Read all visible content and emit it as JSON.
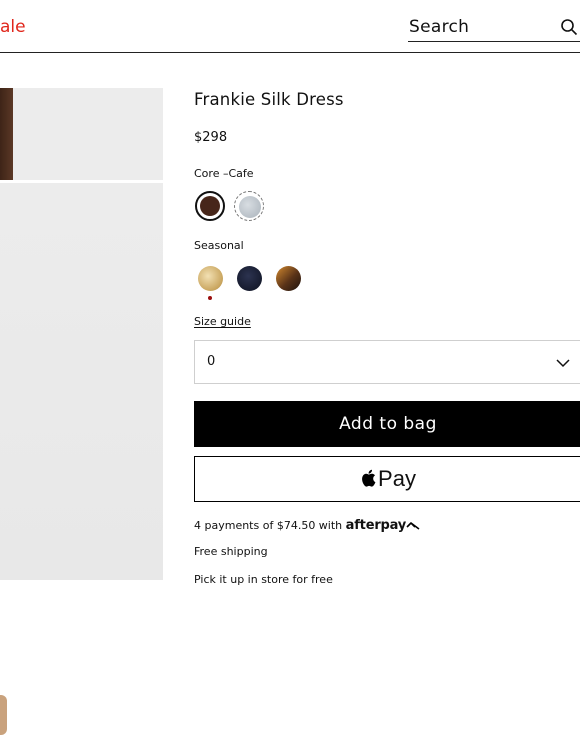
{
  "header": {
    "sale_label": "ale",
    "search_label": "Search",
    "search_icon": "search-icon"
  },
  "product": {
    "title": "Frankie Silk Dress",
    "price": "$298",
    "color_label": "Core –Cafe",
    "core_swatches": [
      {
        "name": "Cafe",
        "color": "#47261a",
        "selected": true
      },
      {
        "name": "grey",
        "color": "#b8c0c7",
        "selected": false
      }
    ],
    "seasonal_label": "Seasonal",
    "seasonal_swatches": [
      {
        "color": "#e6c98d"
      },
      {
        "color": "#1d2238"
      },
      {
        "color": "#8a5326"
      }
    ],
    "size_guide_label": "Size guide",
    "size_value": "0",
    "add_to_bag_label": "Add to bag",
    "apple_pay_label": "Pay",
    "afterpay_text": "4 payments of $74.50 with",
    "afterpay_brand": "afterpay",
    "free_shipping": "Free shipping",
    "pickup_text": "Pick it up in store for free"
  },
  "colors": {
    "sale_red": "#e0261b",
    "button_black": "#000000"
  }
}
